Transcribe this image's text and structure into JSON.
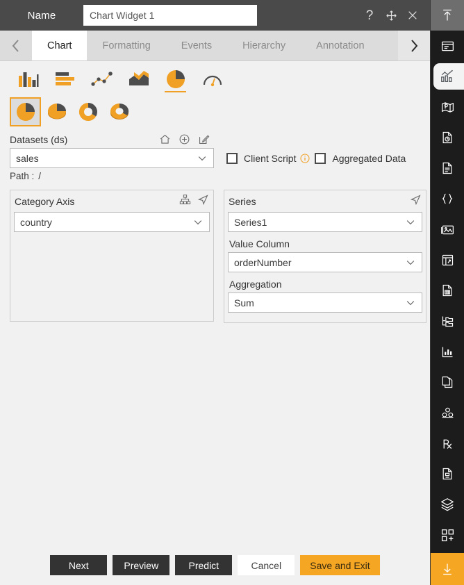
{
  "titlebar": {
    "label": "Name",
    "name_value": "Chart Widget 1",
    "name_placeholder": "Chart Widget 1",
    "help_icon": "question-mark-icon",
    "move_icon": "move-icon",
    "close_icon": "close-icon"
  },
  "tabs": {
    "prev_label": "‹",
    "next_label": "›",
    "items": [
      {
        "label": "Chart",
        "active": true
      },
      {
        "label": "Formatting",
        "active": false
      },
      {
        "label": "Events",
        "active": false
      },
      {
        "label": "Hierarchy",
        "active": false
      },
      {
        "label": "Annotation",
        "active": false
      }
    ]
  },
  "chart_types": {
    "primary": [
      {
        "name": "column-chart-icon",
        "selected": false
      },
      {
        "name": "bar-chart-icon",
        "selected": false
      },
      {
        "name": "scatter-line-chart-icon",
        "selected": false
      },
      {
        "name": "area-chart-icon",
        "selected": false
      },
      {
        "name": "pie-chart-icon",
        "selected": true
      },
      {
        "name": "gauge-chart-icon",
        "selected": false
      }
    ],
    "subtypes": [
      {
        "name": "pie-flat-icon",
        "selected": true
      },
      {
        "name": "pie-3d-icon",
        "selected": false
      },
      {
        "name": "donut-flat-icon",
        "selected": false
      },
      {
        "name": "donut-3d-icon",
        "selected": false
      }
    ]
  },
  "datasets": {
    "title": "Datasets (ds)",
    "home_icon": "home-icon",
    "add_icon": "plus-circle-icon",
    "edit_icon": "edit-pencil-icon",
    "value": "sales",
    "path_label": "Path :",
    "path_value": "/",
    "client_script_label": "Client Script",
    "client_script_checked": false,
    "info_icon": "info-icon",
    "aggregated_data_label": "Aggregated Data",
    "aggregated_data_checked": false
  },
  "category_axis": {
    "title": "Category Axis",
    "hierarchy_icon": "hierarchy-icon",
    "send_icon": "cursor-arrow-icon",
    "value": "country"
  },
  "series": {
    "title": "Series",
    "send_icon": "cursor-arrow-icon",
    "value": "Series1",
    "value_column_label": "Value Column",
    "value_column": "orderNumber",
    "aggregation_label": "Aggregation",
    "aggregation": "Sum"
  },
  "footer": {
    "next": "Next",
    "preview": "Preview",
    "predict": "Predict",
    "cancel": "Cancel",
    "save_and_exit": "Save and Exit"
  },
  "sidebar": {
    "items": [
      {
        "name": "collapse-up-icon",
        "style": "top"
      },
      {
        "name": "dashboard-icon",
        "style": "normal"
      },
      {
        "name": "chart-widget-icon",
        "style": "active"
      },
      {
        "name": "map-widget-icon",
        "style": "normal"
      },
      {
        "name": "report-chart-icon",
        "style": "normal"
      },
      {
        "name": "document-icon",
        "style": "normal"
      },
      {
        "name": "code-braces-icon",
        "style": "normal"
      },
      {
        "name": "image-widget-icon",
        "style": "normal"
      },
      {
        "name": "table-widget-icon",
        "style": "normal"
      },
      {
        "name": "page-report-icon",
        "style": "normal"
      },
      {
        "name": "tree-folder-icon",
        "style": "normal"
      },
      {
        "name": "bar-stats-icon",
        "style": "normal"
      },
      {
        "name": "copy-page-icon",
        "style": "normal"
      },
      {
        "name": "cubes-icon",
        "style": "normal"
      },
      {
        "name": "prescription-rx-icon",
        "style": "normal"
      },
      {
        "name": "saved-doc-icon",
        "style": "normal"
      },
      {
        "name": "layers-icon",
        "style": "normal"
      },
      {
        "name": "add-widget-icon",
        "style": "normal"
      },
      {
        "name": "download-icon",
        "style": "bottom"
      }
    ]
  },
  "colors": {
    "accent": "#f5a623",
    "titlebar": "#4a4a4a",
    "body_bg": "#f1f1f1",
    "sidebar_bg": "#1c1c1c",
    "dark_button": "#333333"
  }
}
